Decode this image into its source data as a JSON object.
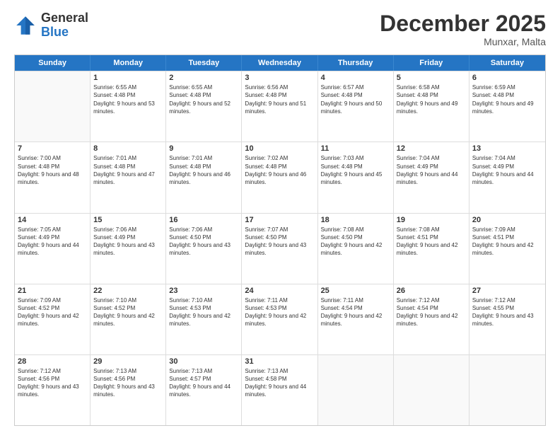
{
  "header": {
    "logo_general": "General",
    "logo_blue": "Blue",
    "month_title": "December 2025",
    "location": "Munxar, Malta"
  },
  "weekdays": [
    "Sunday",
    "Monday",
    "Tuesday",
    "Wednesday",
    "Thursday",
    "Friday",
    "Saturday"
  ],
  "rows": [
    [
      {
        "day": "",
        "empty": true
      },
      {
        "day": "1",
        "sunrise": "6:55 AM",
        "sunset": "4:48 PM",
        "daylight": "9 hours and 53 minutes."
      },
      {
        "day": "2",
        "sunrise": "6:55 AM",
        "sunset": "4:48 PM",
        "daylight": "9 hours and 52 minutes."
      },
      {
        "day": "3",
        "sunrise": "6:56 AM",
        "sunset": "4:48 PM",
        "daylight": "9 hours and 51 minutes."
      },
      {
        "day": "4",
        "sunrise": "6:57 AM",
        "sunset": "4:48 PM",
        "daylight": "9 hours and 50 minutes."
      },
      {
        "day": "5",
        "sunrise": "6:58 AM",
        "sunset": "4:48 PM",
        "daylight": "9 hours and 49 minutes."
      },
      {
        "day": "6",
        "sunrise": "6:59 AM",
        "sunset": "4:48 PM",
        "daylight": "9 hours and 49 minutes."
      }
    ],
    [
      {
        "day": "7",
        "sunrise": "7:00 AM",
        "sunset": "4:48 PM",
        "daylight": "9 hours and 48 minutes."
      },
      {
        "day": "8",
        "sunrise": "7:01 AM",
        "sunset": "4:48 PM",
        "daylight": "9 hours and 47 minutes."
      },
      {
        "day": "9",
        "sunrise": "7:01 AM",
        "sunset": "4:48 PM",
        "daylight": "9 hours and 46 minutes."
      },
      {
        "day": "10",
        "sunrise": "7:02 AM",
        "sunset": "4:48 PM",
        "daylight": "9 hours and 46 minutes."
      },
      {
        "day": "11",
        "sunrise": "7:03 AM",
        "sunset": "4:48 PM",
        "daylight": "9 hours and 45 minutes."
      },
      {
        "day": "12",
        "sunrise": "7:04 AM",
        "sunset": "4:49 PM",
        "daylight": "9 hours and 44 minutes."
      },
      {
        "day": "13",
        "sunrise": "7:04 AM",
        "sunset": "4:49 PM",
        "daylight": "9 hours and 44 minutes."
      }
    ],
    [
      {
        "day": "14",
        "sunrise": "7:05 AM",
        "sunset": "4:49 PM",
        "daylight": "9 hours and 44 minutes."
      },
      {
        "day": "15",
        "sunrise": "7:06 AM",
        "sunset": "4:49 PM",
        "daylight": "9 hours and 43 minutes."
      },
      {
        "day": "16",
        "sunrise": "7:06 AM",
        "sunset": "4:50 PM",
        "daylight": "9 hours and 43 minutes."
      },
      {
        "day": "17",
        "sunrise": "7:07 AM",
        "sunset": "4:50 PM",
        "daylight": "9 hours and 43 minutes."
      },
      {
        "day": "18",
        "sunrise": "7:08 AM",
        "sunset": "4:50 PM",
        "daylight": "9 hours and 42 minutes."
      },
      {
        "day": "19",
        "sunrise": "7:08 AM",
        "sunset": "4:51 PM",
        "daylight": "9 hours and 42 minutes."
      },
      {
        "day": "20",
        "sunrise": "7:09 AM",
        "sunset": "4:51 PM",
        "daylight": "9 hours and 42 minutes."
      }
    ],
    [
      {
        "day": "21",
        "sunrise": "7:09 AM",
        "sunset": "4:52 PM",
        "daylight": "9 hours and 42 minutes."
      },
      {
        "day": "22",
        "sunrise": "7:10 AM",
        "sunset": "4:52 PM",
        "daylight": "9 hours and 42 minutes."
      },
      {
        "day": "23",
        "sunrise": "7:10 AM",
        "sunset": "4:53 PM",
        "daylight": "9 hours and 42 minutes."
      },
      {
        "day": "24",
        "sunrise": "7:11 AM",
        "sunset": "4:53 PM",
        "daylight": "9 hours and 42 minutes."
      },
      {
        "day": "25",
        "sunrise": "7:11 AM",
        "sunset": "4:54 PM",
        "daylight": "9 hours and 42 minutes."
      },
      {
        "day": "26",
        "sunrise": "7:12 AM",
        "sunset": "4:54 PM",
        "daylight": "9 hours and 42 minutes."
      },
      {
        "day": "27",
        "sunrise": "7:12 AM",
        "sunset": "4:55 PM",
        "daylight": "9 hours and 43 minutes."
      }
    ],
    [
      {
        "day": "28",
        "sunrise": "7:12 AM",
        "sunset": "4:56 PM",
        "daylight": "9 hours and 43 minutes."
      },
      {
        "day": "29",
        "sunrise": "7:13 AM",
        "sunset": "4:56 PM",
        "daylight": "9 hours and 43 minutes."
      },
      {
        "day": "30",
        "sunrise": "7:13 AM",
        "sunset": "4:57 PM",
        "daylight": "9 hours and 44 minutes."
      },
      {
        "day": "31",
        "sunrise": "7:13 AM",
        "sunset": "4:58 PM",
        "daylight": "9 hours and 44 minutes."
      },
      {
        "day": "",
        "empty": true
      },
      {
        "day": "",
        "empty": true
      },
      {
        "day": "",
        "empty": true
      }
    ]
  ]
}
